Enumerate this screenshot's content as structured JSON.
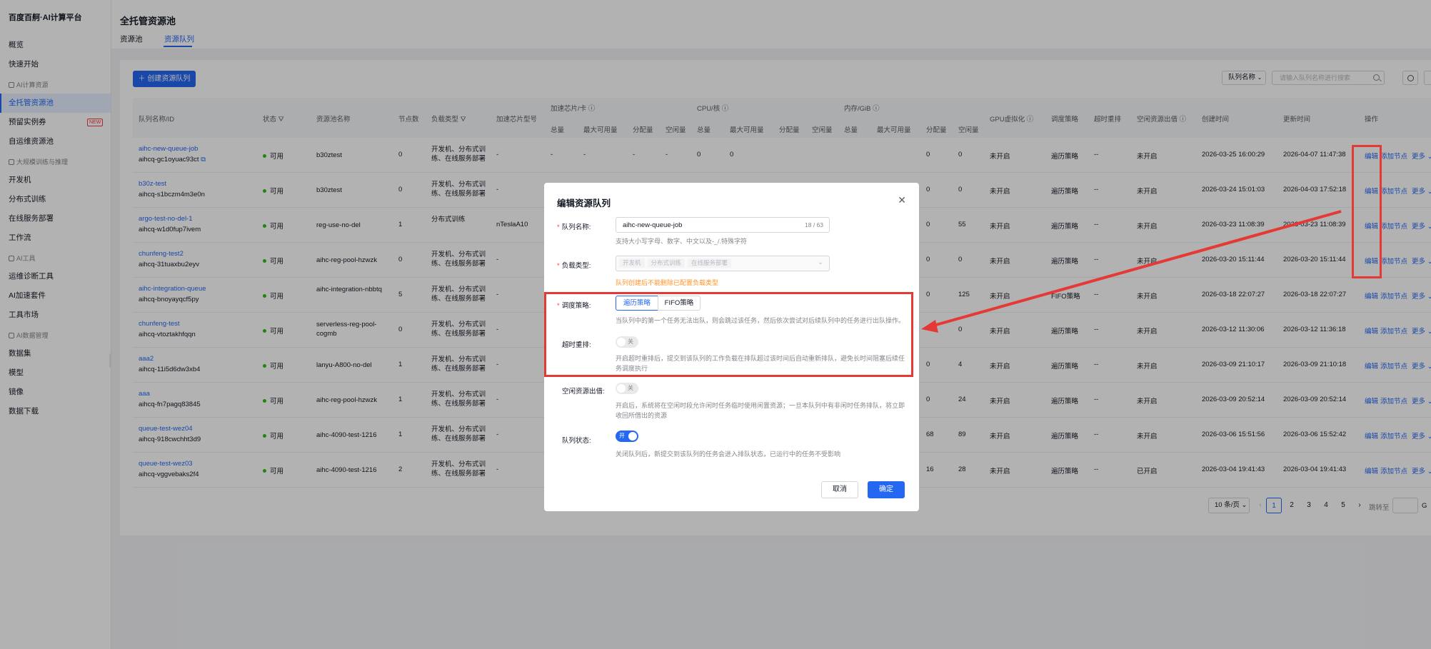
{
  "app": {
    "brand": "百度百舸·AI计算平台"
  },
  "sidebar": {
    "items": [
      {
        "label": "概览",
        "type": "item"
      },
      {
        "label": "快速开始",
        "type": "item"
      },
      {
        "label": "AI计算资源",
        "type": "group"
      },
      {
        "label": "全托管资源池",
        "type": "item",
        "active": true
      },
      {
        "label": "预留实例券",
        "type": "item",
        "badge": "NEW"
      },
      {
        "label": "自运维资源池",
        "type": "item"
      },
      {
        "label": "大规模训练与推理",
        "type": "group"
      },
      {
        "label": "开发机",
        "type": "item"
      },
      {
        "label": "分布式训练",
        "type": "item"
      },
      {
        "label": "在线服务部署",
        "type": "item"
      },
      {
        "label": "工作流",
        "type": "item"
      },
      {
        "label": "AI工具",
        "type": "group"
      },
      {
        "label": "运维诊断工具",
        "type": "item"
      },
      {
        "label": "AI加速套件",
        "type": "item"
      },
      {
        "label": "工具市场",
        "type": "item"
      },
      {
        "label": "AI数据管理",
        "type": "group"
      },
      {
        "label": "数据集",
        "type": "item"
      },
      {
        "label": "模型",
        "type": "item"
      },
      {
        "label": "镜像",
        "type": "item"
      },
      {
        "label": "数据下载",
        "type": "item"
      }
    ]
  },
  "header": {
    "title": "全托管资源池",
    "tabs": [
      "资源池",
      "资源队列"
    ],
    "active_tab": 1
  },
  "toolbar": {
    "create_label": "创建资源队列",
    "filter_select": "队列名称",
    "search_placeholder": "请输入队列名称进行搜索"
  },
  "table": {
    "group_headers": {
      "accel": "加速芯片/卡",
      "cpu": "CPU/核",
      "mem": "内存/GiB"
    },
    "columns": {
      "name": "队列名称/ID",
      "status": "状态",
      "pool": "资源池名称",
      "nodes": "节点数",
      "load": "负载类型",
      "chip": "加速芯片型号",
      "total": "总量",
      "max_avail": "最大可用量",
      "allocated": "分配量",
      "idle": "空闲量",
      "gpu_virt": "GPU虚拟化",
      "sched": "调度策略",
      "timeout": "超时重排",
      "idle_borrow": "空闲资源出借",
      "created": "创建时间",
      "updated": "更新时间",
      "ops": "操作"
    },
    "ops": {
      "edit": "编辑",
      "add_node": "添加节点",
      "more": "更多"
    },
    "rows": [
      {
        "name": "aihc-new-queue-job",
        "id": "aihcq-gc1oyuac93ct",
        "status": "可用",
        "pool": "b30ztest",
        "nodes": "0",
        "load": "开发机、分布式训练、在线服务部署",
        "chip": "-",
        "a_total": "-",
        "a_max": "-",
        "a_alloc": "-",
        "a_idle": "-",
        "c_total": "0",
        "c_max": "0",
        "m_alloc": "0",
        "m_idle": "0",
        "gpu_virt": "未开启",
        "sched": "遍历策略",
        "timeout": "--",
        "borrow": "未开启",
        "created": "2026-03-25 16:00:29",
        "updated": "2026-04-07 11:47:38"
      },
      {
        "name": "b30z-test",
        "id": "aihcq-s1bczm4m3e0n",
        "status": "可用",
        "pool": "b30ztest",
        "nodes": "0",
        "load": "开发机、分布式训练、在线服务部署",
        "chip": "-",
        "m_alloc": "0",
        "m_idle": "0",
        "gpu_virt": "未开启",
        "sched": "遍历策略",
        "timeout": "--",
        "borrow": "未开启",
        "created": "2026-03-24 15:01:03",
        "updated": "2026-04-03 17:52:18"
      },
      {
        "name": "argo-test-no-del-1",
        "id": "aihcq-w1d0fup7ivem",
        "status": "可用",
        "pool": "reg-use-no-del",
        "nodes": "1",
        "load": "分布式训练",
        "chip": "nTeslaA10",
        "m_alloc": "0",
        "m_idle": "55",
        "gpu_virt": "未开启",
        "sched": "遍历策略",
        "timeout": "--",
        "borrow": "未开启",
        "created": "2026-03-23 11:08:39",
        "updated": "2026-03-23 11:08:39"
      },
      {
        "name": "chunfeng-test2",
        "id": "aihcq-31tuaxbu2eyv",
        "status": "可用",
        "pool": "aihc-reg-pool-hzwzk",
        "nodes": "0",
        "load": "开发机、分布式训练、在线服务部署",
        "chip": "-",
        "m_alloc": "0",
        "m_idle": "0",
        "gpu_virt": "未开启",
        "sched": "遍历策略",
        "timeout": "--",
        "borrow": "未开启",
        "created": "2026-03-20 15:11:44",
        "updated": "2026-03-20 15:11:44"
      },
      {
        "name": "aihc-integration-queue",
        "id": "aihcq-bnoyayqcf5py",
        "status": "可用",
        "pool": "aihc-integration-nbbtq",
        "nodes": "5",
        "load": "开发机、分布式训练、在线服务部署",
        "chip": "-",
        "m_alloc": "0",
        "m_idle": "125",
        "gpu_virt": "未开启",
        "sched": "FIFO策略",
        "timeout": "--",
        "borrow": "未开启",
        "created": "2026-03-18 22:07:27",
        "updated": "2026-03-18 22:07:27"
      },
      {
        "name": "chunfeng-test",
        "id": "aihcq-vtoztakhfqqn",
        "status": "可用",
        "pool": "serverless-reg-pool-cogmb",
        "nodes": "0",
        "load": "开发机、分布式训练、在线服务部署",
        "chip": "-",
        "m_alloc": "",
        "m_idle": "0",
        "gpu_virt": "未开启",
        "sched": "遍历策略",
        "timeout": "--",
        "borrow": "未开启",
        "created": "2026-03-12 11:30:06",
        "updated": "2026-03-12 11:36:18"
      },
      {
        "name": "aaa2",
        "id": "aihcq-11i5d6dw3xb4",
        "status": "可用",
        "pool": "lanyu-A800-no-del",
        "nodes": "1",
        "load": "开发机、分布式训练、在线服务部署",
        "chip": "-",
        "m_alloc": "0",
        "m_idle": "4",
        "gpu_virt": "未开启",
        "sched": "遍历策略",
        "timeout": "--",
        "borrow": "未开启",
        "created": "2026-03-09 21:10:17",
        "updated": "2026-03-09 21:10:18"
      },
      {
        "name": "aaa",
        "id": "aihcq-fn7pagq83845",
        "status": "可用",
        "pool": "aihc-reg-pool-hzwzk",
        "nodes": "1",
        "load": "开发机、分布式训练、在线服务部署",
        "chip": "-",
        "m_alloc": "0",
        "m_idle": "24",
        "gpu_virt": "未开启",
        "sched": "遍历策略",
        "timeout": "--",
        "borrow": "未开启",
        "created": "2026-03-09 20:52:14",
        "updated": "2026-03-09 20:52:14"
      },
      {
        "name": "queue-test-wez04",
        "id": "aihcq-918cwchht3d9",
        "status": "可用",
        "pool": "aihc-4090-test-1216",
        "nodes": "1",
        "load": "开发机、分布式训练、在线服务部署",
        "chip": "-",
        "m_alloc": "68",
        "m_idle": "89",
        "gpu_virt": "未开启",
        "sched": "遍历策略",
        "timeout": "--",
        "borrow": "未开启",
        "created": "2026-03-06 15:51:56",
        "updated": "2026-03-06 15:52:42"
      },
      {
        "name": "queue-test-wez03",
        "id": "aihcq-vggvebaks2f4",
        "status": "可用",
        "pool": "aihc-4090-test-1216",
        "nodes": "2",
        "load": "开发机、分布式训练、在线服务部署",
        "chip": "-",
        "m_alloc": "16",
        "m_idle": "28",
        "gpu_virt": "未开启",
        "sched": "遍历策略",
        "timeout": "--",
        "borrow": "已开启",
        "created": "2026-03-04 19:41:43",
        "updated": "2026-03-04 19:41:43"
      }
    ]
  },
  "pagination": {
    "page_size": "10 条/页",
    "pages": [
      "1",
      "2",
      "3",
      "4",
      "5"
    ],
    "current": "1",
    "jump_label": "跳转至",
    "go": "G"
  },
  "modal": {
    "title": "编辑资源队列",
    "name_label": "队列名称:",
    "name_value": "aihc-new-queue-job",
    "name_count": "18 / 63",
    "name_hint": "支持大小写字母、数字、中文以及-_/.特殊字符",
    "load_label": "负载类型:",
    "load_tags": [
      "开发机",
      "分布式训练",
      "在线服务部署"
    ],
    "load_warn": "队列创建后不能删除已配置负载类型",
    "sched_label": "调度策略:",
    "sched_options": [
      "遍历策略",
      "FIFO策略"
    ],
    "sched_hint": "当队列中的第一个任务无法出队，则会跳过该任务，然后依次尝试对后续队列中的任务进行出队操作。",
    "timeout_label": "超时重排:",
    "timeout_switch": "关",
    "timeout_hint": "开启超时重排后，提交到该队列的工作负载在排队超过该时间后自动重新排队，避免长时间阻塞后续任务调度执行",
    "borrow_label": "空闲资源出借:",
    "borrow_switch": "关",
    "borrow_hint": "开启后，系统将在空闲时段允许闲时任务临时使用闲置资源；一旦本队列中有非闲时任务排队，将立即收回所借出的资源",
    "status_label": "队列状态:",
    "status_switch": "开",
    "status_hint": "关闭队列后，新提交到该队列的任务会进入排队状态，已运行中的任务不受影响",
    "cancel": "取消",
    "confirm": "确定"
  },
  "annotation_color": "#e53935"
}
